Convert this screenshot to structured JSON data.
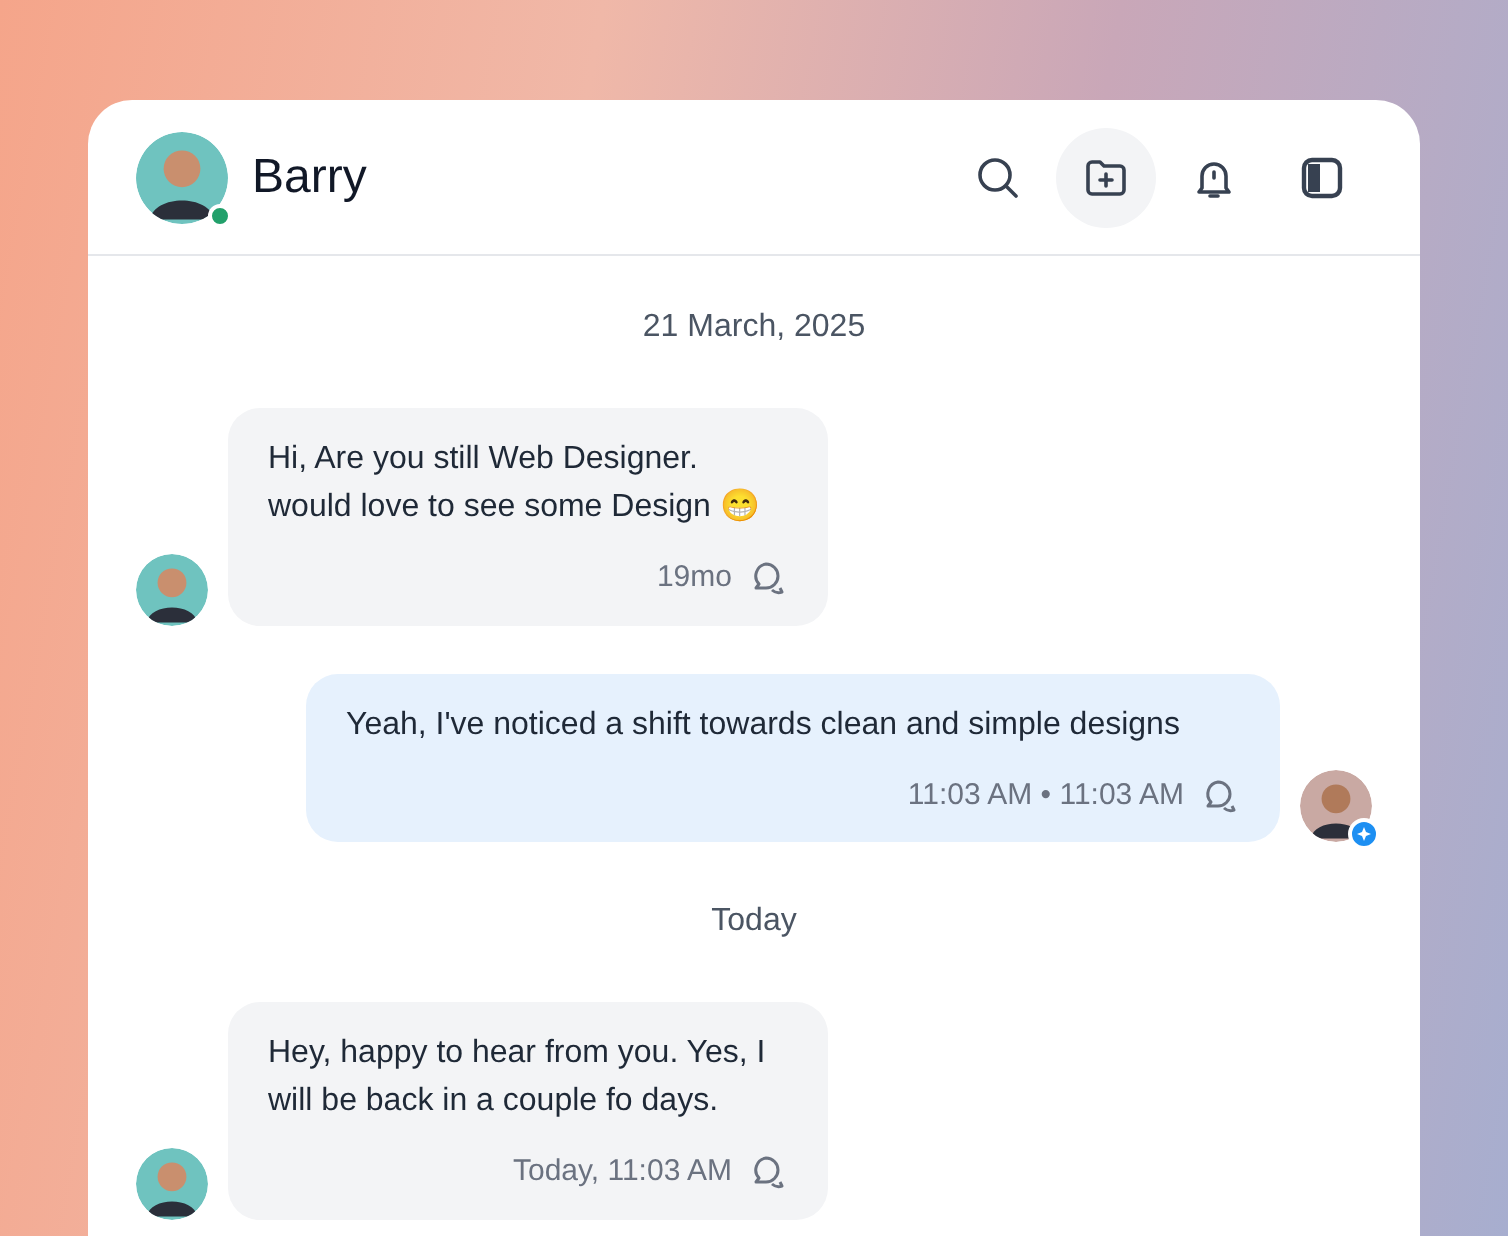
{
  "header": {
    "name": "Barry",
    "online": true
  },
  "toolbar": [
    {
      "kind": "search",
      "selected": false
    },
    {
      "kind": "folder-add",
      "selected": true
    },
    {
      "kind": "bell",
      "selected": false
    },
    {
      "kind": "panel",
      "selected": false
    }
  ],
  "messages": [
    {
      "kind": "date",
      "text": "21 March, 2025"
    },
    {
      "kind": "incoming",
      "text": "Hi, Are you still Web Designer. would love to see some Design 😁",
      "time": "19mo",
      "verified": false
    },
    {
      "kind": "outgoing",
      "text": "Yeah, I've noticed a shift towards clean and simple designs",
      "time": "11:03 AM • 11:03 AM",
      "verified": true
    },
    {
      "kind": "date",
      "text": "Today"
    },
    {
      "kind": "incoming",
      "text": "Hey, happy to hear from you. Yes, I will be back in a couple fo days.",
      "time": "Today, 11:03 AM",
      "verified": false
    }
  ]
}
